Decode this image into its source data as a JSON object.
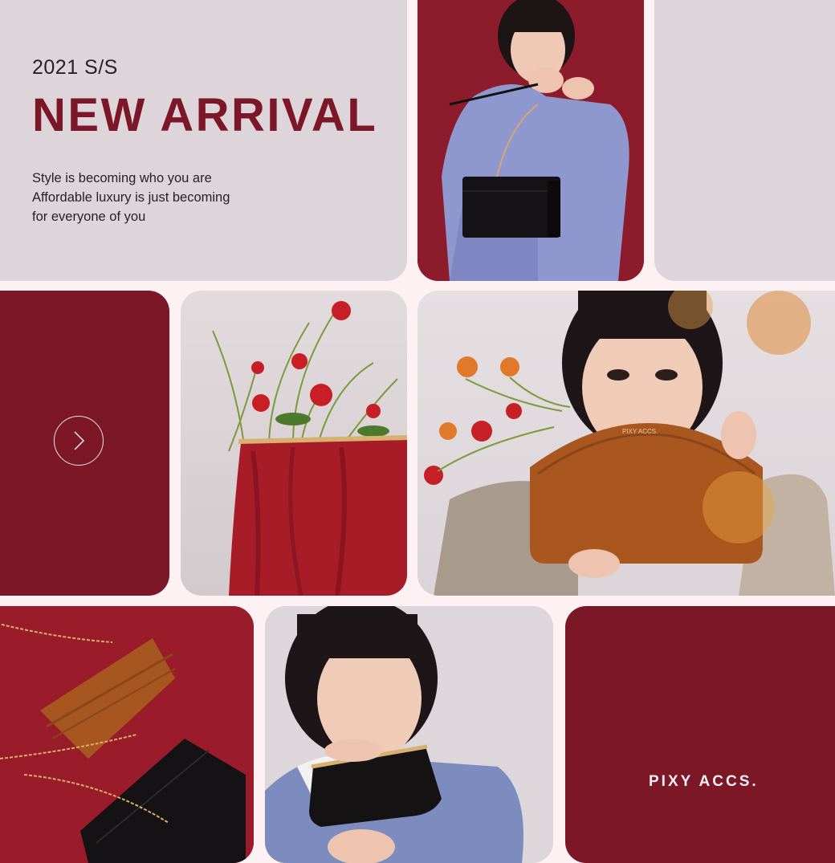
{
  "hero": {
    "season": "2021 S/S",
    "headline": "NEW ARRIVAL",
    "tagline": [
      "Style is becoming who you are",
      "Affordable luxury is just becoming",
      "for everyone of you"
    ]
  },
  "brand": {
    "name": "PIXY ACCS."
  },
  "photos": {
    "model_bag": "model-with-black-crossbody-bag",
    "flower_bag": "red-pouch-bag-with-flowers",
    "model_brown_bag": "model-with-brown-croc-bag",
    "wallets": "brown-and-black-chain-wallets",
    "model_clutch": "model-with-black-clutch"
  },
  "bag_logo_text": "PIXY ACCS.",
  "colors": {
    "maroon": "#7b1726",
    "lavender": "#ded5da",
    "background": "#fdf1f3"
  },
  "icons": {
    "next": "chevron-right-icon"
  }
}
